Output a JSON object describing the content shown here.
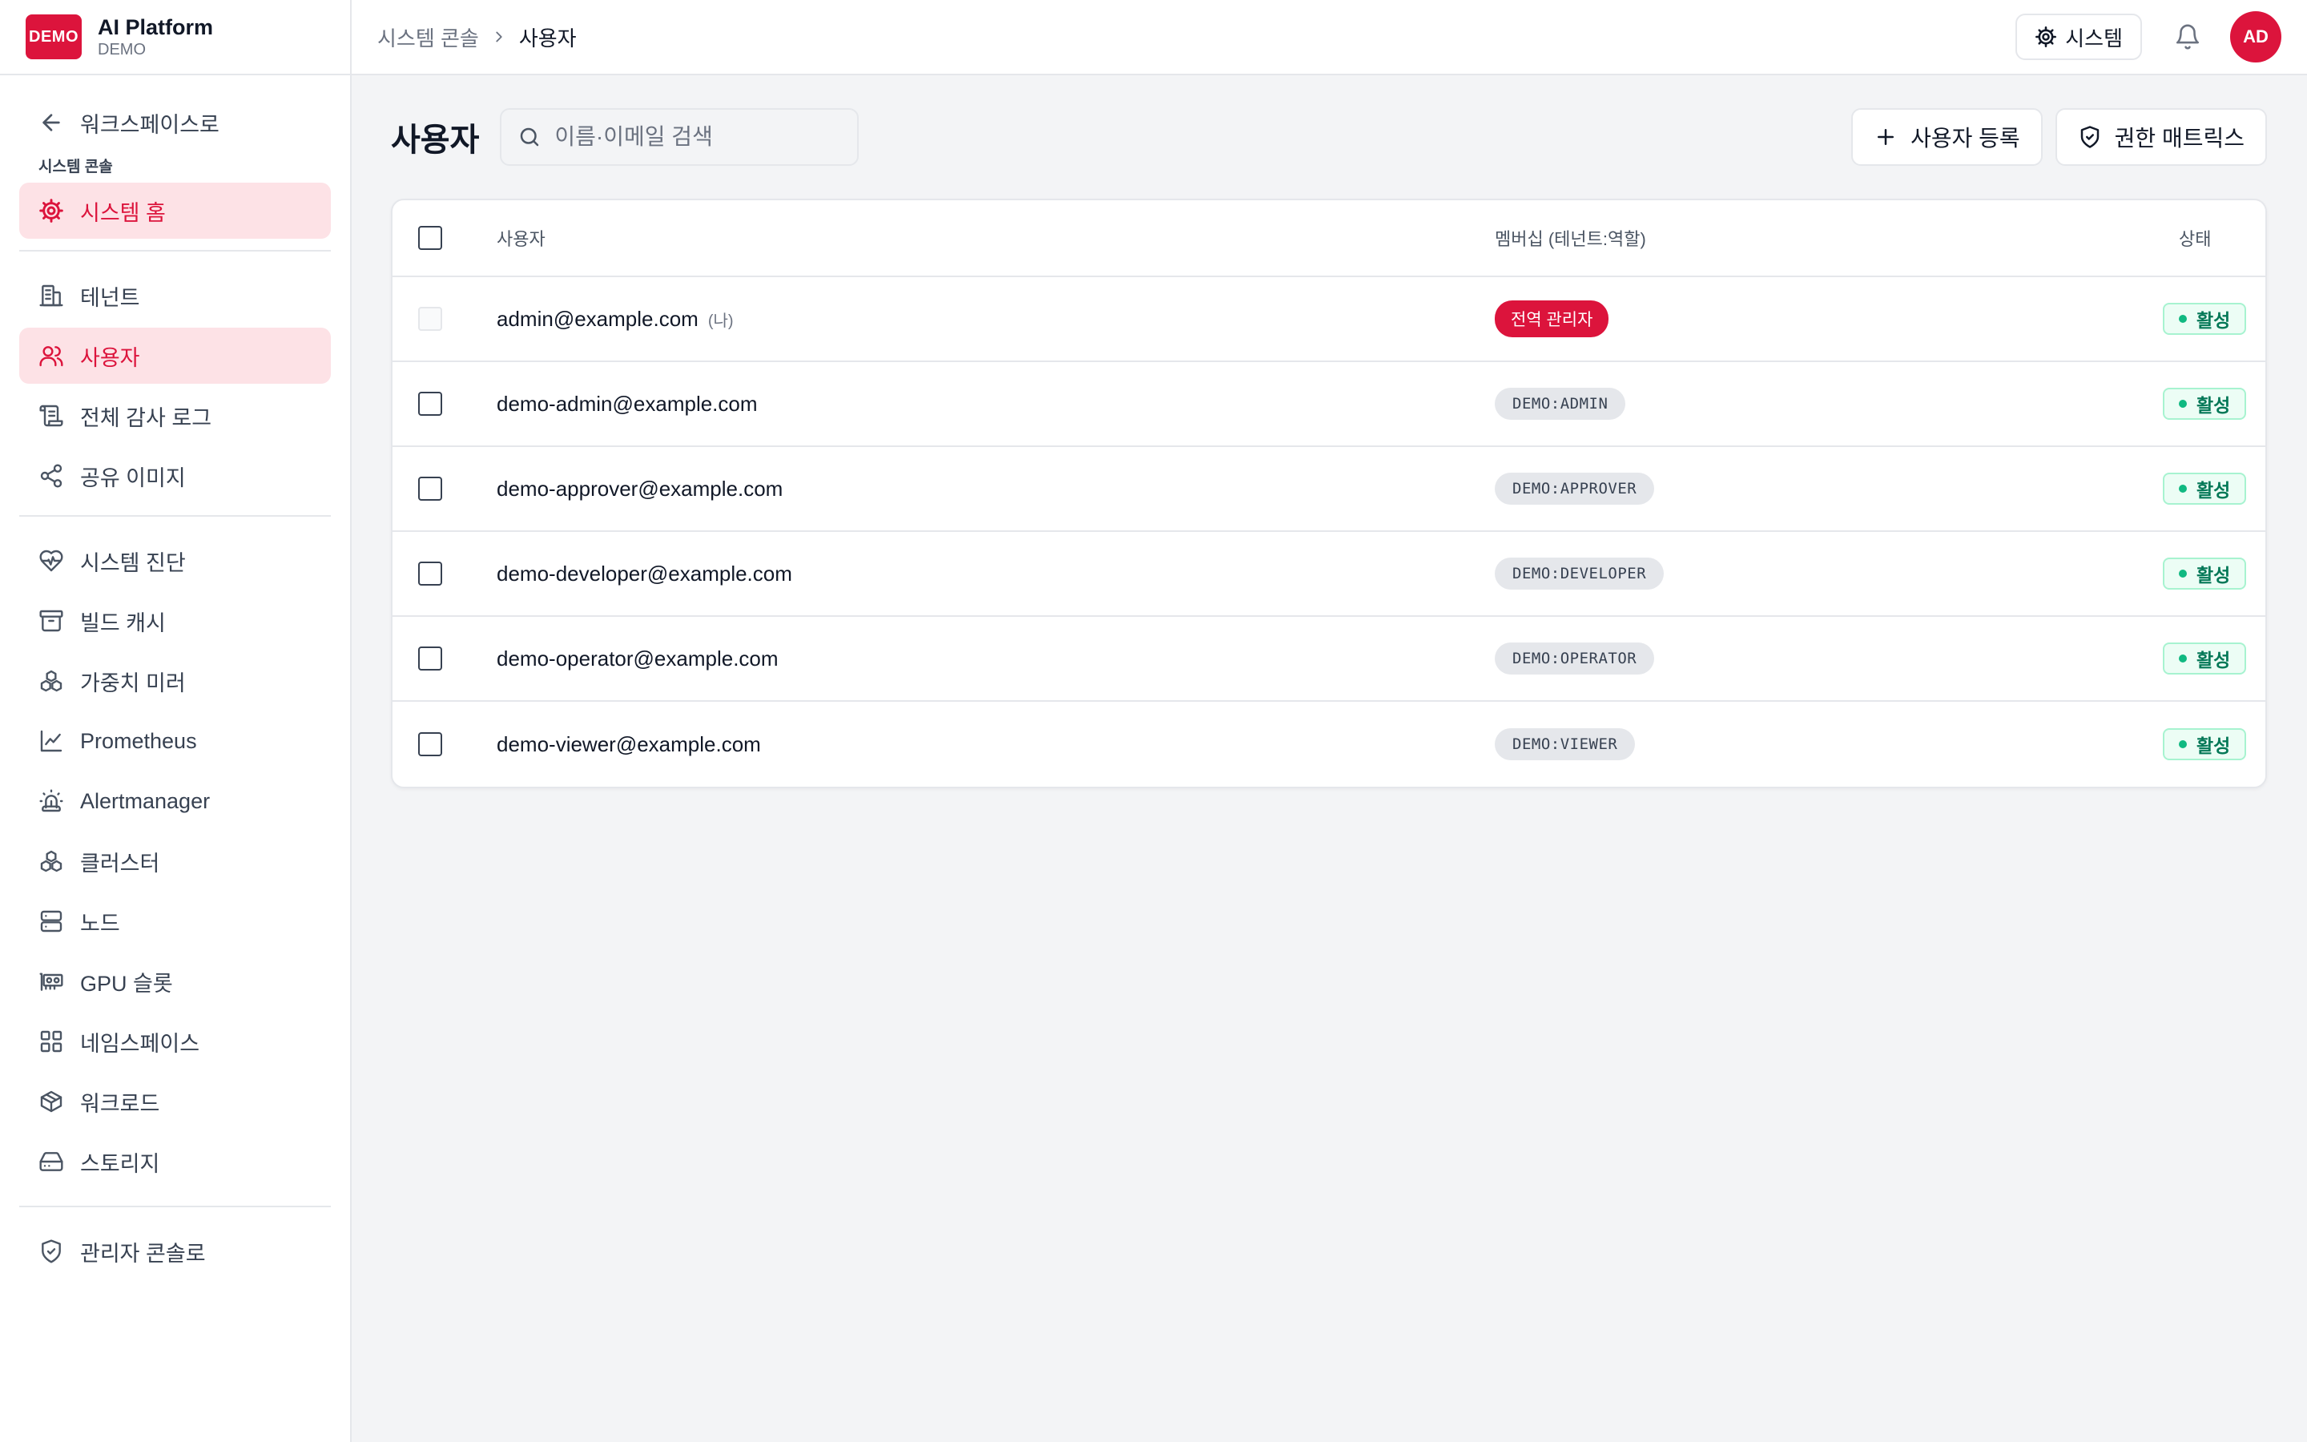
{
  "brand": {
    "logo_text": "DEMO",
    "title": "AI Platform",
    "subtitle": "DEMO"
  },
  "sidebar": {
    "back_label": "워크스페이스로",
    "section_label": "시스템 콘솔",
    "home_label": "시스템 홈",
    "group1": [
      {
        "label": "테넌트",
        "icon": "building-icon"
      },
      {
        "label": "사용자",
        "icon": "users-icon",
        "active": true
      },
      {
        "label": "전체 감사 로그",
        "icon": "scroll-icon"
      },
      {
        "label": "공유 이미지",
        "icon": "share-icon"
      }
    ],
    "group2": [
      {
        "label": "시스템 진단",
        "icon": "heart-pulse-icon"
      },
      {
        "label": "빌드 캐시",
        "icon": "archive-icon"
      },
      {
        "label": "가중치 미러",
        "icon": "boxes-icon"
      },
      {
        "label": "Prometheus",
        "icon": "line-chart-icon"
      },
      {
        "label": "Alertmanager",
        "icon": "siren-icon"
      },
      {
        "label": "클러스터",
        "icon": "cluster-icon"
      },
      {
        "label": "노드",
        "icon": "server-icon"
      },
      {
        "label": "GPU 슬롯",
        "icon": "gpu-icon"
      },
      {
        "label": "네임스페이스",
        "icon": "grid-icon"
      },
      {
        "label": "워크로드",
        "icon": "package-icon"
      },
      {
        "label": "스토리지",
        "icon": "hard-drive-icon"
      }
    ],
    "admin_label": "관리자 콘솔로"
  },
  "topbar": {
    "breadcrumb_parent": "시스템 콘솔",
    "breadcrumb_current": "사용자",
    "system_button": "시스템",
    "avatar_initials": "AD"
  },
  "page": {
    "title": "사용자",
    "search_placeholder": "이름·이메일 검색",
    "register_button": "사용자 등록",
    "matrix_button": "권한 매트릭스"
  },
  "table": {
    "headers": {
      "user": "사용자",
      "membership": "멤버십 (테넌트:역할)",
      "status": "상태"
    },
    "me_tag": "(나)",
    "rows": [
      {
        "email": "admin@example.com",
        "membership": "전역 관리자",
        "status": "활성"
      },
      {
        "email": "demo-admin@example.com",
        "membership": "DEMO:ADMIN",
        "status": "활성"
      },
      {
        "email": "demo-approver@example.com",
        "membership": "DEMO:APPROVER",
        "status": "활성"
      },
      {
        "email": "demo-developer@example.com",
        "membership": "DEMO:DEVELOPER",
        "status": "활성"
      },
      {
        "email": "demo-operator@example.com",
        "membership": "DEMO:OPERATOR",
        "status": "활성"
      },
      {
        "email": "demo-viewer@example.com",
        "membership": "DEMO:VIEWER",
        "status": "활성"
      }
    ]
  },
  "colors": {
    "accent": "#dc143c",
    "active_bg": "#fde2e6",
    "status_green": "#047857"
  }
}
